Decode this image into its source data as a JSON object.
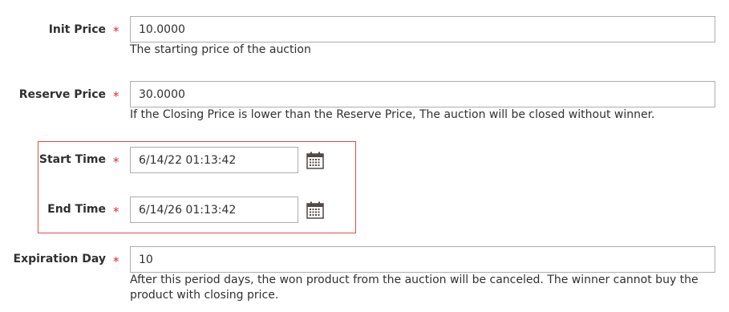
{
  "fields": {
    "init_price": {
      "label": "Init Price",
      "required_mark": "*",
      "value": "10.0000",
      "note": "The starting price of the auction"
    },
    "reserve_price": {
      "label": "Reserve Price",
      "required_mark": "*",
      "value": "30.0000",
      "note": "If the Closing Price is lower than the Reserve Price, The auction will be closed without winner."
    },
    "start_time": {
      "label": "Start Time",
      "required_mark": "*",
      "value": "6/14/22 01:13:42",
      "icon": "calendar-icon"
    },
    "end_time": {
      "label": "End Time",
      "required_mark": "*",
      "value": "6/14/26 01:13:42",
      "icon": "calendar-icon"
    },
    "expiration_day": {
      "label": "Expiration Day",
      "required_mark": "*",
      "value": "10",
      "note": "After this period days, the won product from the auction will be canceled. The winner cannot buy the product with closing price."
    }
  },
  "colors": {
    "required": "#e22626",
    "highlight_border": "#e04b4b",
    "input_border": "#adadad",
    "text": "#303030"
  }
}
